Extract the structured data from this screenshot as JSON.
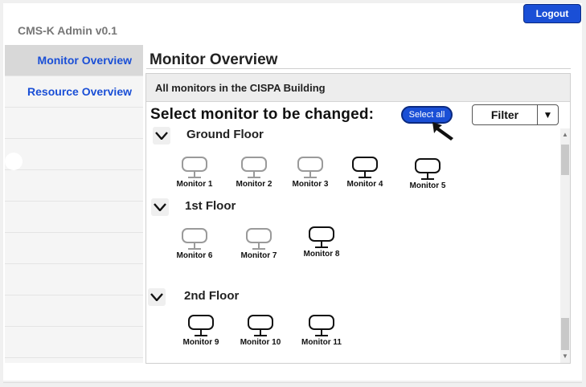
{
  "app": {
    "title": "CMS-K Admin v0.1",
    "logout_label": "Logout"
  },
  "sidebar": {
    "items": [
      {
        "label": "Monitor Overview"
      },
      {
        "label": "Resource Overview"
      }
    ]
  },
  "main": {
    "title": "Monitor Overview",
    "panel_heading": "All monitors in the CISPA Building",
    "select_prompt": "Select monitor to be changed:",
    "select_all_label": "Select all",
    "filter_label": "Filter"
  },
  "floors": [
    {
      "name": "Ground Floor",
      "monitors": [
        {
          "label": "Monitor 1",
          "state": "inactive"
        },
        {
          "label": "Monitor 2",
          "state": "inactive"
        },
        {
          "label": "Monitor 3",
          "state": "inactive"
        },
        {
          "label": "Monitor 4",
          "state": "active"
        },
        {
          "label": "Monitor 5",
          "state": "active"
        }
      ]
    },
    {
      "name": "1st Floor",
      "monitors": [
        {
          "label": "Monitor 6",
          "state": "inactive"
        },
        {
          "label": "Monitor 7",
          "state": "inactive"
        },
        {
          "label": "Monitor 8",
          "state": "active"
        }
      ]
    },
    {
      "name": "2nd Floor",
      "monitors": [
        {
          "label": "Monitor 9",
          "state": "active"
        },
        {
          "label": "Monitor 10",
          "state": "active"
        },
        {
          "label": "Monitor 11",
          "state": "active"
        }
      ]
    }
  ],
  "icons": {
    "monitor": "monitor-icon",
    "chevron": "chevron-down-icon",
    "filter_arrow": "caret-down-icon",
    "cursor": "mouse-cursor-icon"
  },
  "colors": {
    "accent": "#1a4fd6",
    "inactive_monitor": "#9a9a9a",
    "active_monitor": "#111111"
  }
}
